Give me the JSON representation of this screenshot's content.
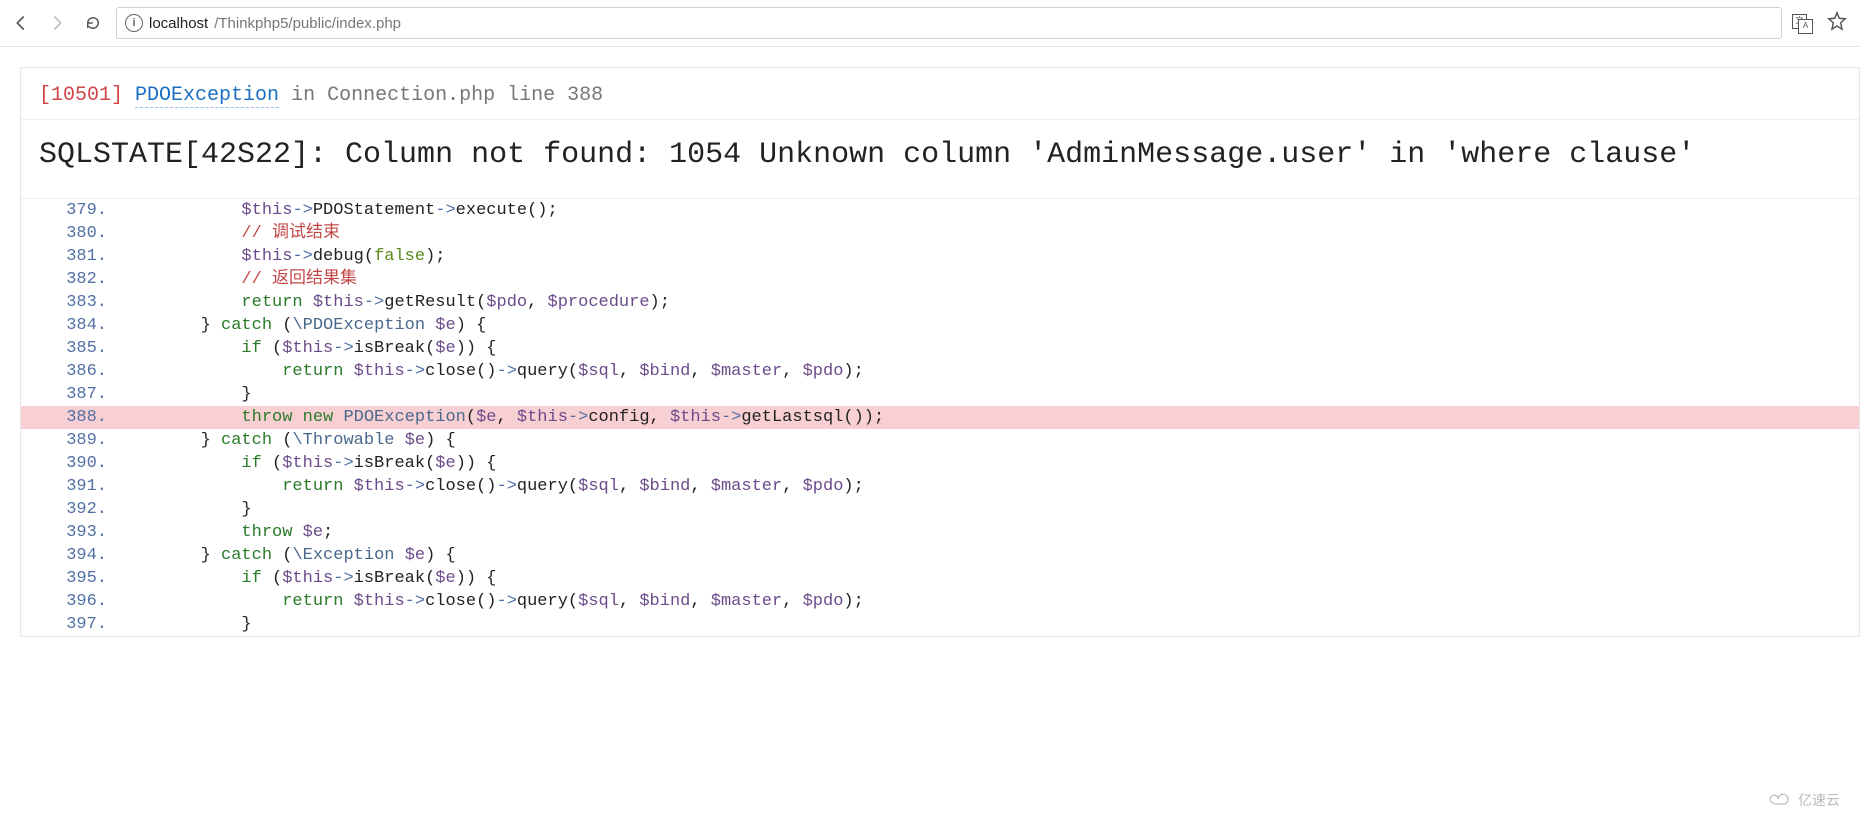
{
  "toolbar": {
    "url_origin": "localhost",
    "url_path": "/Thinkphp5/public/index.php"
  },
  "error": {
    "code": "[10501]",
    "exception": "PDOException",
    "in_word": "in",
    "file_line": "Connection.php line 388",
    "message": "SQLSTATE[42S22]: Column not found: 1054 Unknown column 'AdminMessage.user' in 'where clause'"
  },
  "code": {
    "highlight_line": 388,
    "lines": [
      {
        "n": 379,
        "tokens": [
          [
            "p",
            "            "
          ],
          [
            "v",
            "$this"
          ],
          [
            "o",
            "->"
          ],
          [
            "p",
            "PDOStatement"
          ],
          [
            "o",
            "->"
          ],
          [
            "p",
            "execute"
          ],
          [
            "p",
            "();"
          ]
        ]
      },
      {
        "n": 380,
        "tokens": [
          [
            "p",
            "            "
          ],
          [
            "c",
            "// 调试结束"
          ]
        ]
      },
      {
        "n": 381,
        "tokens": [
          [
            "p",
            "            "
          ],
          [
            "v",
            "$this"
          ],
          [
            "o",
            "->"
          ],
          [
            "p",
            "debug"
          ],
          [
            "p",
            "("
          ],
          [
            "b",
            "false"
          ],
          [
            "p",
            ");"
          ]
        ]
      },
      {
        "n": 382,
        "tokens": [
          [
            "p",
            "            "
          ],
          [
            "c",
            "// 返回结果集"
          ]
        ]
      },
      {
        "n": 383,
        "tokens": [
          [
            "p",
            "            "
          ],
          [
            "k",
            "return"
          ],
          [
            "p",
            " "
          ],
          [
            "v",
            "$this"
          ],
          [
            "o",
            "->"
          ],
          [
            "p",
            "getResult"
          ],
          [
            "p",
            "("
          ],
          [
            "v",
            "$pdo"
          ],
          [
            "p",
            ", "
          ],
          [
            "v",
            "$procedure"
          ],
          [
            "p",
            ");"
          ]
        ]
      },
      {
        "n": 384,
        "tokens": [
          [
            "p",
            "        } "
          ],
          [
            "k",
            "catch"
          ],
          [
            "p",
            " ("
          ],
          [
            "t",
            "\\PDOException"
          ],
          [
            "p",
            " "
          ],
          [
            "v",
            "$e"
          ],
          [
            "p",
            ") {"
          ]
        ]
      },
      {
        "n": 385,
        "tokens": [
          [
            "p",
            "            "
          ],
          [
            "k",
            "if"
          ],
          [
            "p",
            " ("
          ],
          [
            "v",
            "$this"
          ],
          [
            "o",
            "->"
          ],
          [
            "p",
            "isBreak"
          ],
          [
            "p",
            "("
          ],
          [
            "v",
            "$e"
          ],
          [
            "p",
            ")) {"
          ]
        ]
      },
      {
        "n": 386,
        "tokens": [
          [
            "p",
            "                "
          ],
          [
            "k",
            "return"
          ],
          [
            "p",
            " "
          ],
          [
            "v",
            "$this"
          ],
          [
            "o",
            "->"
          ],
          [
            "p",
            "close"
          ],
          [
            "p",
            "()"
          ],
          [
            "o",
            "->"
          ],
          [
            "p",
            "query"
          ],
          [
            "p",
            "("
          ],
          [
            "v",
            "$sql"
          ],
          [
            "p",
            ", "
          ],
          [
            "v",
            "$bind"
          ],
          [
            "p",
            ", "
          ],
          [
            "v",
            "$master"
          ],
          [
            "p",
            ", "
          ],
          [
            "v",
            "$pdo"
          ],
          [
            "p",
            ");"
          ]
        ]
      },
      {
        "n": 387,
        "tokens": [
          [
            "p",
            "            }"
          ]
        ]
      },
      {
        "n": 388,
        "tokens": [
          [
            "p",
            "            "
          ],
          [
            "k",
            "throw"
          ],
          [
            "p",
            " "
          ],
          [
            "k",
            "new"
          ],
          [
            "p",
            " "
          ],
          [
            "t",
            "PDOException"
          ],
          [
            "p",
            "("
          ],
          [
            "v",
            "$e"
          ],
          [
            "p",
            ", "
          ],
          [
            "v",
            "$this"
          ],
          [
            "o",
            "->"
          ],
          [
            "p",
            "config"
          ],
          [
            "p",
            ", "
          ],
          [
            "v",
            "$this"
          ],
          [
            "o",
            "->"
          ],
          [
            "p",
            "getLastsql"
          ],
          [
            "p",
            "());"
          ]
        ]
      },
      {
        "n": 389,
        "tokens": [
          [
            "p",
            "        } "
          ],
          [
            "k",
            "catch"
          ],
          [
            "p",
            " ("
          ],
          [
            "t",
            "\\Throwable"
          ],
          [
            "p",
            " "
          ],
          [
            "v",
            "$e"
          ],
          [
            "p",
            ") {"
          ]
        ]
      },
      {
        "n": 390,
        "tokens": [
          [
            "p",
            "            "
          ],
          [
            "k",
            "if"
          ],
          [
            "p",
            " ("
          ],
          [
            "v",
            "$this"
          ],
          [
            "o",
            "->"
          ],
          [
            "p",
            "isBreak"
          ],
          [
            "p",
            "("
          ],
          [
            "v",
            "$e"
          ],
          [
            "p",
            ")) {"
          ]
        ]
      },
      {
        "n": 391,
        "tokens": [
          [
            "p",
            "                "
          ],
          [
            "k",
            "return"
          ],
          [
            "p",
            " "
          ],
          [
            "v",
            "$this"
          ],
          [
            "o",
            "->"
          ],
          [
            "p",
            "close"
          ],
          [
            "p",
            "()"
          ],
          [
            "o",
            "->"
          ],
          [
            "p",
            "query"
          ],
          [
            "p",
            "("
          ],
          [
            "v",
            "$sql"
          ],
          [
            "p",
            ", "
          ],
          [
            "v",
            "$bind"
          ],
          [
            "p",
            ", "
          ],
          [
            "v",
            "$master"
          ],
          [
            "p",
            ", "
          ],
          [
            "v",
            "$pdo"
          ],
          [
            "p",
            ");"
          ]
        ]
      },
      {
        "n": 392,
        "tokens": [
          [
            "p",
            "            }"
          ]
        ]
      },
      {
        "n": 393,
        "tokens": [
          [
            "p",
            "            "
          ],
          [
            "k",
            "throw"
          ],
          [
            "p",
            " "
          ],
          [
            "v",
            "$e"
          ],
          [
            "p",
            ";"
          ]
        ]
      },
      {
        "n": 394,
        "tokens": [
          [
            "p",
            "        } "
          ],
          [
            "k",
            "catch"
          ],
          [
            "p",
            " ("
          ],
          [
            "t",
            "\\Exception"
          ],
          [
            "p",
            " "
          ],
          [
            "v",
            "$e"
          ],
          [
            "p",
            ") {"
          ]
        ]
      },
      {
        "n": 395,
        "tokens": [
          [
            "p",
            "            "
          ],
          [
            "k",
            "if"
          ],
          [
            "p",
            " ("
          ],
          [
            "v",
            "$this"
          ],
          [
            "o",
            "->"
          ],
          [
            "p",
            "isBreak"
          ],
          [
            "p",
            "("
          ],
          [
            "v",
            "$e"
          ],
          [
            "p",
            ")) {"
          ]
        ]
      },
      {
        "n": 396,
        "tokens": [
          [
            "p",
            "                "
          ],
          [
            "k",
            "return"
          ],
          [
            "p",
            " "
          ],
          [
            "v",
            "$this"
          ],
          [
            "o",
            "->"
          ],
          [
            "p",
            "close"
          ],
          [
            "p",
            "()"
          ],
          [
            "o",
            "->"
          ],
          [
            "p",
            "query"
          ],
          [
            "p",
            "("
          ],
          [
            "v",
            "$sql"
          ],
          [
            "p",
            ", "
          ],
          [
            "v",
            "$bind"
          ],
          [
            "p",
            ", "
          ],
          [
            "v",
            "$master"
          ],
          [
            "p",
            ", "
          ],
          [
            "v",
            "$pdo"
          ],
          [
            "p",
            ");"
          ]
        ]
      },
      {
        "n": 397,
        "tokens": [
          [
            "p",
            "            }"
          ]
        ]
      }
    ]
  },
  "watermark": "亿速云"
}
